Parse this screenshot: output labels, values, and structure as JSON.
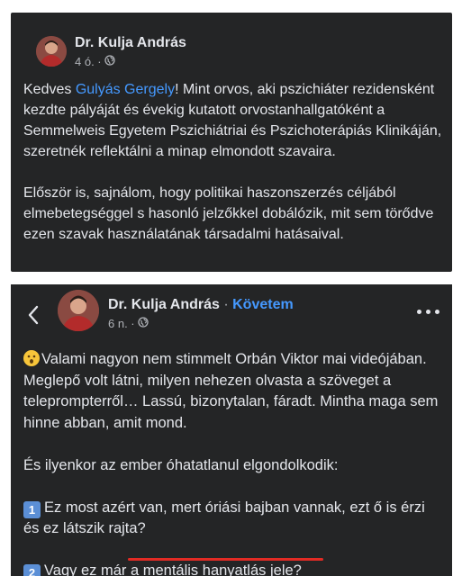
{
  "post1": {
    "author": "Dr. Kulja András",
    "time": "4 ó. ·",
    "mention": "Gulyás Gergely",
    "greeting": "Kedves ",
    "para1_rest": "! Mint orvos, aki pszichiáter rezidensként kezdte pályáját és évekig kutatott orvostanhallgatóként a Semmelweis Egyetem Pszichiátriai és Pszichoterápiás Klinikáján, szeretnék reflektálni a minap elmondott szavaira.",
    "para2": "Először is, sajnálom, hogy politikai haszonszerzés céljából elmebetegséggel s hasonló jelzőkkel dobálózik, mit sem törődve ezen szavak használatának társadalmi hatásaival."
  },
  "post2": {
    "author": "Dr. Kulja András",
    "separator": " · ",
    "follow_label": "Követem",
    "time": "6 n. ·",
    "para1": "Valami nagyon nem stimmelt Orbán Viktor mai videójában. Meglepő volt látni, milyen nehezen olvasta a szöveget a teleprompterről… Lassú, bizonytalan, fáradt. Mintha maga sem hinne abban, amit mond.",
    "para2": "És ilyenkor az ember óhatatlanul elgondolkodik:",
    "item1_num": "1",
    "item1_text": "Ez most azért van, mert óriási bajban vannak, ezt ő is érzi és ez látszik rajta?",
    "item2_num": "2",
    "item2_text": "Vagy ez már a mentális hanyatlás jele?"
  },
  "icons": {
    "globe": "globe-icon",
    "back": "back-chevron-icon",
    "more": "more-options-icon",
    "emoji": "hushed-face-emoji",
    "keycap1": "keycap-1-emoji",
    "keycap2": "keycap-2-emoji"
  },
  "colors": {
    "panel_bg": "#242526",
    "text": "#e4e6eb",
    "muted": "#b0b3b8",
    "link": "#4599ff",
    "underline": "#e22b24"
  }
}
